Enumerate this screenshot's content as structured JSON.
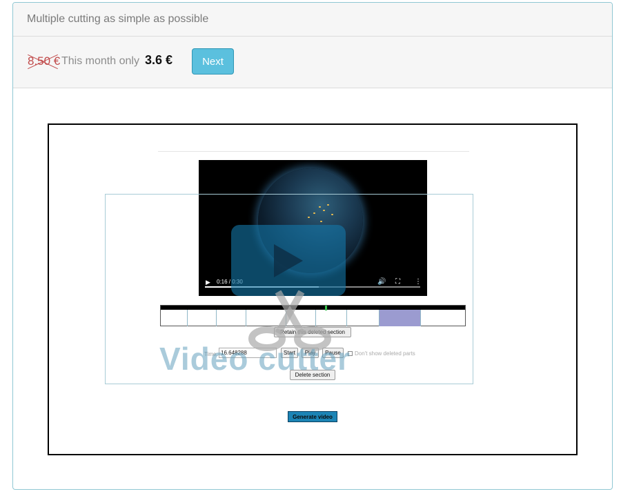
{
  "header": {
    "title": "Multiple cutting as simple as possible"
  },
  "pricing": {
    "old_price": "8.50 €",
    "offer_text": "This month only",
    "new_price": "3.6 €",
    "next_label": "Next"
  },
  "preview": {
    "video": {
      "time_display": "0:16 / 0:30",
      "progress_fraction": 0.53
    },
    "timeline": {
      "cursor_fraction": 0.54,
      "segment_boundaries": [
        0.0,
        0.087,
        0.182,
        0.28,
        0.41,
        0.507,
        0.61,
        0.716,
        0.852,
        1.0
      ],
      "deleted_segment_index": 7
    },
    "retain_label": "Retain this deleted section",
    "time_label": "Time:",
    "time_value": "16.648288",
    "start_label": "Start",
    "play_label": "Play",
    "pause_label": "Pause",
    "dont_show_label": "Don't show deleted parts",
    "delete_label": "Delete section",
    "generate_label": "Generate video",
    "watermark": "Video cutter"
  },
  "colors": {
    "accent": "#5bc0de",
    "old_price": "#c14b4b",
    "deleted_segment": "#9b9bd0",
    "generate_button": "#1c84b5"
  }
}
